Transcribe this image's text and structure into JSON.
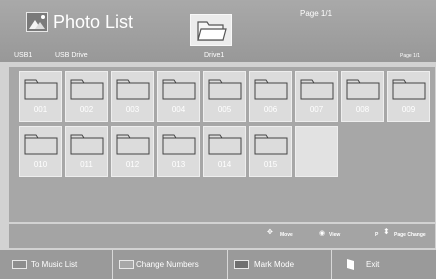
{
  "header": {
    "title": "Photo List",
    "page_indicator": "Page 1/1",
    "breadcrumb_device": "USB1",
    "breadcrumb_drive": "USB Drive",
    "current_folder": "Drive1",
    "page_small": "Page 1/1"
  },
  "grid": {
    "items": [
      {
        "label": "001"
      },
      {
        "label": "002"
      },
      {
        "label": "003"
      },
      {
        "label": "004"
      },
      {
        "label": "005"
      },
      {
        "label": "006"
      },
      {
        "label": "007"
      },
      {
        "label": "008"
      },
      {
        "label": "009"
      },
      {
        "label": "010"
      },
      {
        "label": "011"
      },
      {
        "label": "012"
      },
      {
        "label": "013"
      },
      {
        "label": "014"
      },
      {
        "label": "015"
      }
    ]
  },
  "hints": {
    "move": "Move",
    "view": "View",
    "page_change_key": "P",
    "page_change": "Page Change"
  },
  "buttons": {
    "music": {
      "label": "To Music List",
      "color": "#8e8e8e"
    },
    "numbers": {
      "label": "Change Numbers",
      "color": "#a8a8a8"
    },
    "mark": {
      "label": "Mark Mode",
      "color": "#707070"
    },
    "exit": {
      "label": "Exit"
    }
  },
  "icons": {
    "app": "photo-icon",
    "folder": "open-folder-icon",
    "item": "folder-icon",
    "move": "dpad-icon",
    "view": "ok-button-icon",
    "page": "page-rocker-icon",
    "exit": "exit-icon"
  }
}
